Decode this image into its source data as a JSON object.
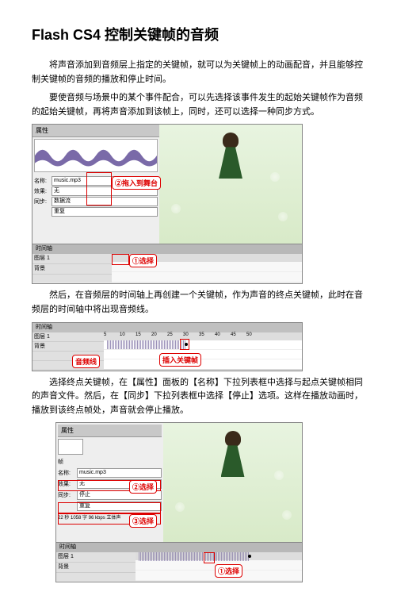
{
  "title": "Flash CS4    控制关键帧的音频",
  "para1": "将声音添加到音频层上指定的关键帧，就可以为关键帧上的动画配音，并且能够控制关键帧的音频的播放和停止时间。",
  "para2": "要使音频与场景中的某个事件配合，可以先选择该事件发生的起始关键帧作为音频的起始关键帧，再将声音添加到该帧上，同时，还可以选择一种同步方式。",
  "para3": "然后，在音频层的时间轴上再创建一个关键帧，作为声音的终点关键帧，此时在音频层的时间轴中将出现音频线。",
  "para4": "选择终点关键帧，在【属性】面板的【名称】下拉列表框中选择与起点关键帧相同的声音文件。然后，在【同步】下拉列表框中选择【停止】选项。这样在播放动画时，播放到该终点帧处，声音就会停止播放。",
  "fig1": {
    "panel_title": "属性",
    "row_name_label": "名称:",
    "row_name_value": "music.mp3",
    "row_effect_label": "效果:",
    "row_effect_value": "无",
    "row_sync_label": "同步:",
    "row_sync_value": "数据流",
    "row_repeat_value": "重复",
    "callout_drag_num": "②",
    "callout_drag": "拖入到舞台",
    "callout_select_num": "①",
    "callout_select": "选择",
    "layer1": "图层 1",
    "layer2": "背景",
    "tl_title": "时间轴"
  },
  "fig2": {
    "tl_title": "时间轴",
    "layer1": "图层 1",
    "layer2": "背景",
    "callout_audio": "音频线",
    "callout_insert": "插入关键帧",
    "ruler": [
      "5",
      "10",
      "15",
      "20",
      "25",
      "30",
      "35",
      "40",
      "45",
      "50"
    ]
  },
  "fig3": {
    "panel_title": "属性",
    "swatch_label": "帧",
    "name_label": "名称:",
    "name_value": "music.mp3",
    "effect_label": "效果:",
    "effect_value": "无",
    "sync_label": "同步:",
    "sync_value": "停止",
    "repeat_value": "重复",
    "info_line": "22 秒 1058 字 96 kbps 立体声",
    "callout2_num": "②",
    "callout2": "选择",
    "callout3_num": "③",
    "callout3": "选择",
    "callout1_num": "①",
    "callout1": "选择",
    "layer1": "图层 1",
    "layer2": "背景",
    "tl_title": "时间轴"
  }
}
